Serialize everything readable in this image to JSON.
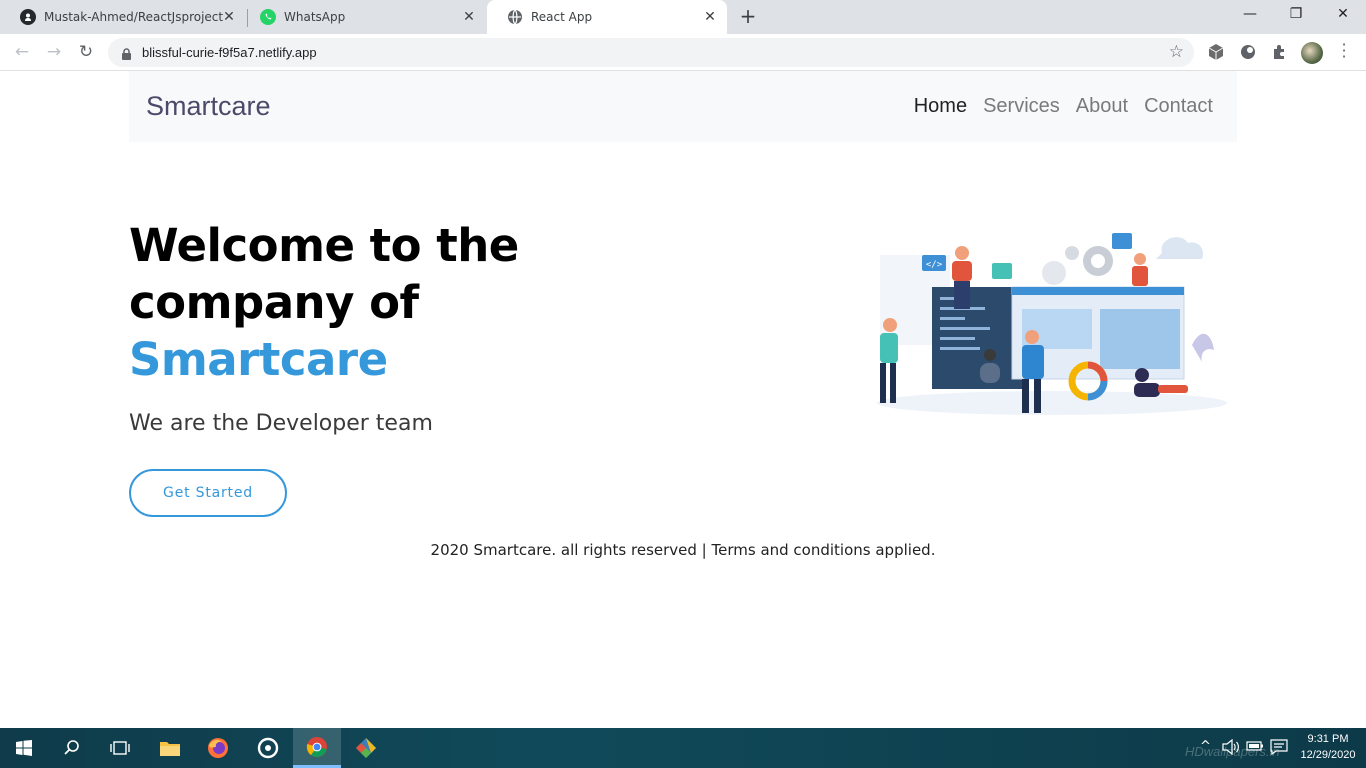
{
  "browser": {
    "tabs": [
      {
        "title": "Mustak-Ahmed/ReactJsproject",
        "icon": "github-icon"
      },
      {
        "title": "WhatsApp",
        "icon": "whatsapp-icon"
      },
      {
        "title": "React App",
        "icon": "globe-icon",
        "active": true
      }
    ],
    "url": "blissful-curie-f9f5a7.netlify.app"
  },
  "site": {
    "brand": "Smartcare",
    "nav": [
      "Home",
      "Services",
      "About",
      "Contact"
    ],
    "active_nav": "Home",
    "hero": {
      "title_line1": "Welcome to the",
      "title_line2": "company of",
      "title_brand": "Smartcare",
      "subtitle": "We are the Developer team",
      "cta": "Get Started"
    },
    "footer": "2020 Smartcare. all rights reserved | Terms and conditions applied."
  },
  "taskbar": {
    "time": "9:31 PM",
    "date": "12/29/2020",
    "watermark": "HDwallpapers.in"
  },
  "colors": {
    "accent": "#3498db",
    "navbar_bg": "#f8f9fa",
    "tabstrip_bg": "#dee1e6",
    "taskbar_bg": "#104a5a"
  }
}
